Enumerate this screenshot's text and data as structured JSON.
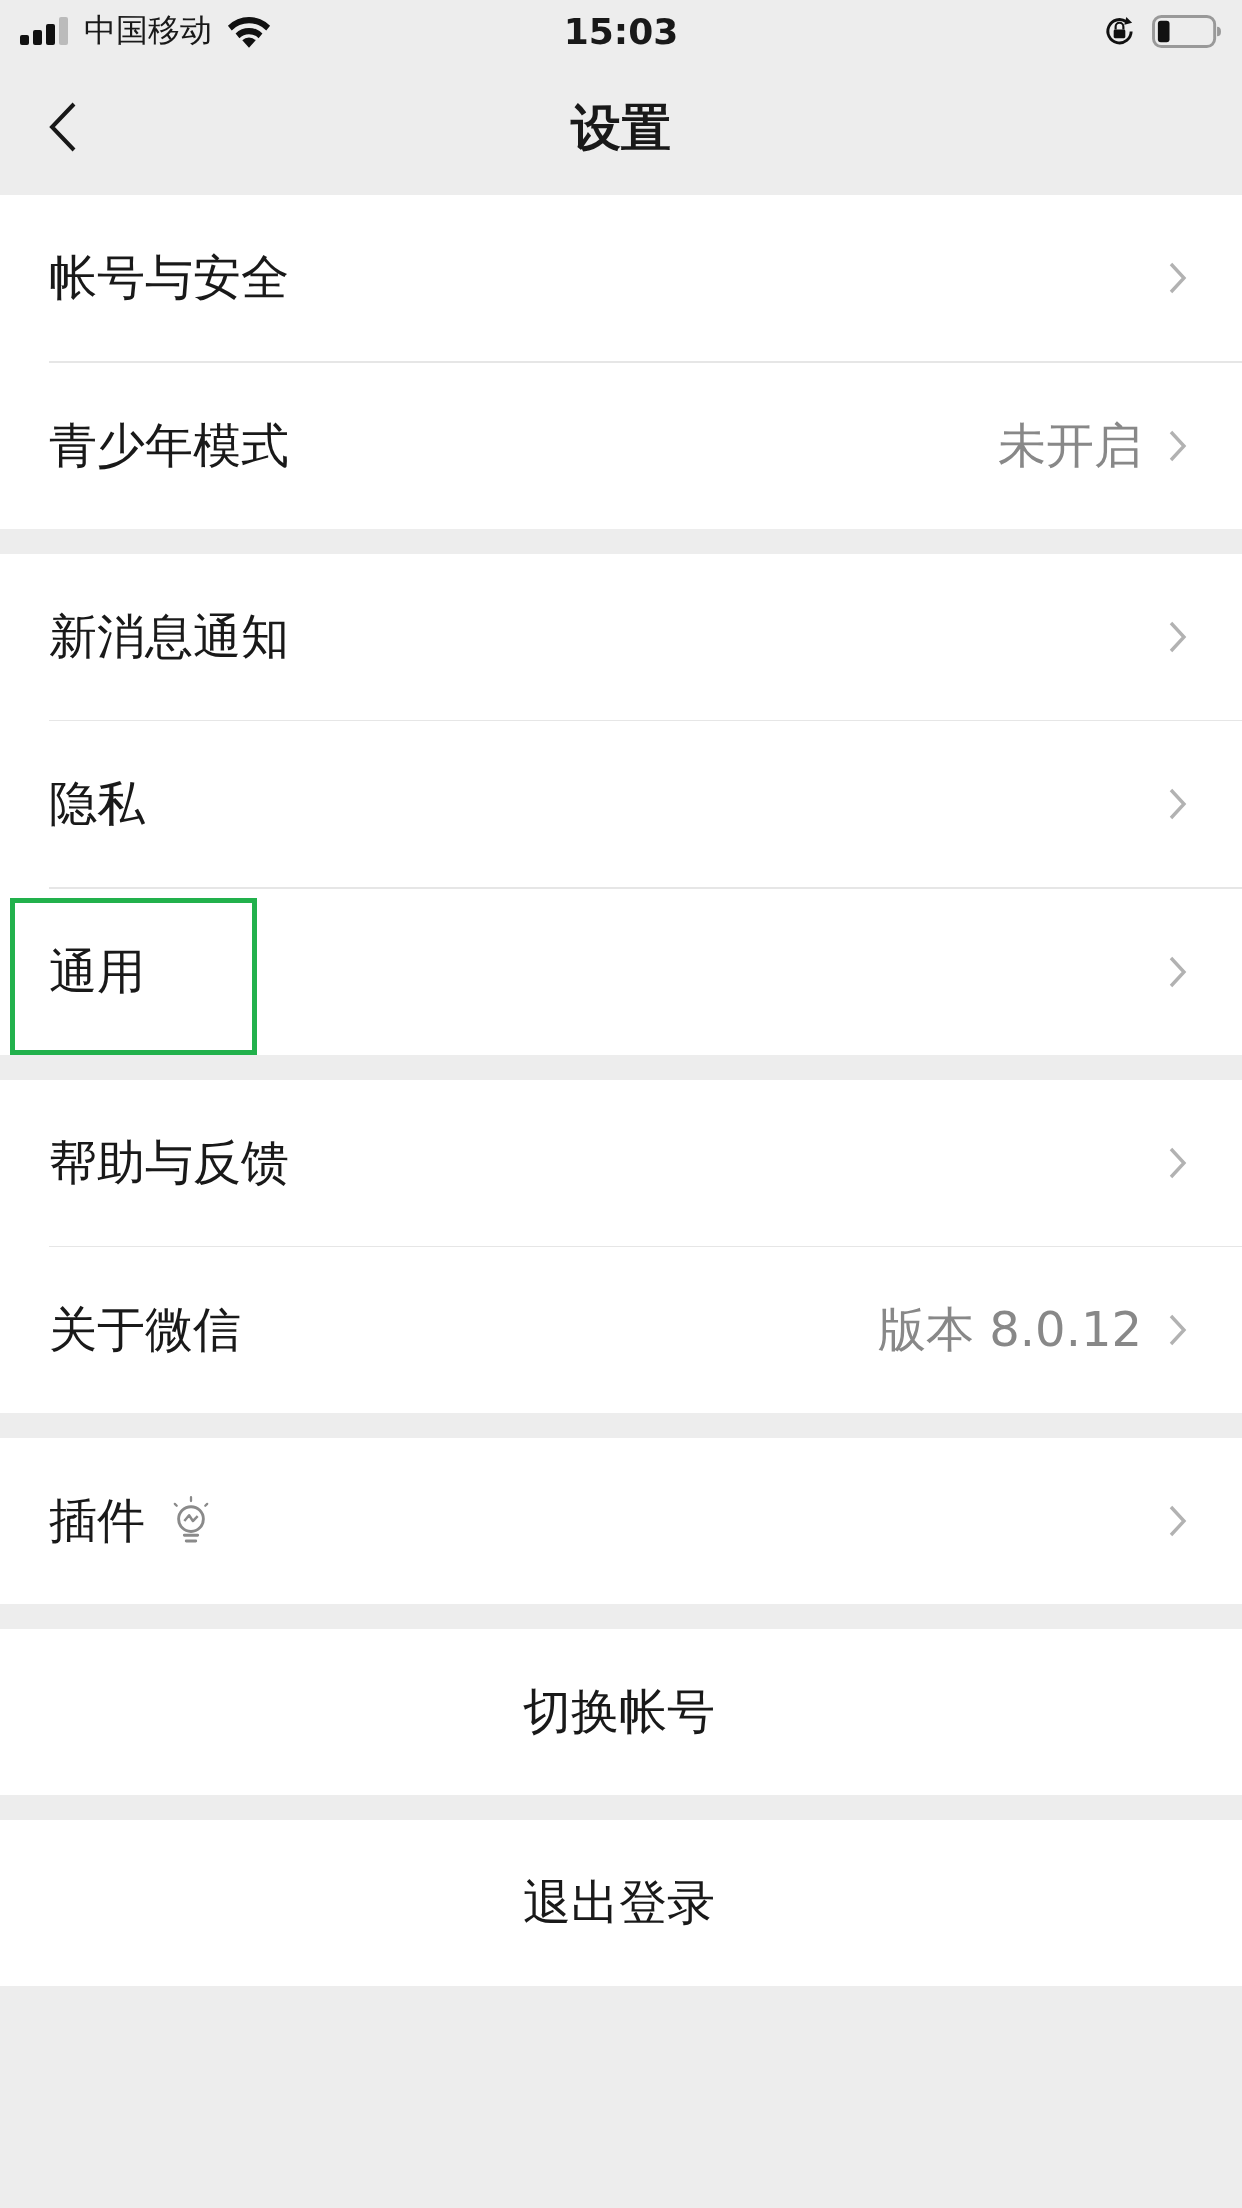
{
  "status_bar": {
    "carrier": "中国移动",
    "time": "15:03"
  },
  "nav_bar": {
    "title": "设置"
  },
  "groups": [
    {
      "items": [
        {
          "kind": "link",
          "label": "帐号与安全",
          "highlighted": false
        },
        {
          "kind": "link",
          "label": "青少年模式",
          "value": "未开启",
          "highlighted": false
        }
      ]
    },
    {
      "items": [
        {
          "kind": "link",
          "label": "新消息通知",
          "highlighted": false
        },
        {
          "kind": "link",
          "label": "隐私",
          "highlighted": false
        },
        {
          "kind": "link",
          "label": "通用",
          "highlighted": true
        }
      ]
    },
    {
      "items": [
        {
          "kind": "link",
          "label": "帮助与反馈",
          "highlighted": false
        },
        {
          "kind": "link",
          "label": "关于微信",
          "value": "版本 8.0.12",
          "highlighted": false
        }
      ]
    },
    {
      "items": [
        {
          "kind": "link_icon",
          "label": "插件",
          "highlighted": false
        }
      ]
    },
    {
      "items": [
        {
          "kind": "action",
          "label": "切换帐号",
          "highlighted": false
        }
      ]
    },
    {
      "items": [
        {
          "kind": "action",
          "label": "退出登录",
          "highlighted": false
        }
      ]
    }
  ]
}
